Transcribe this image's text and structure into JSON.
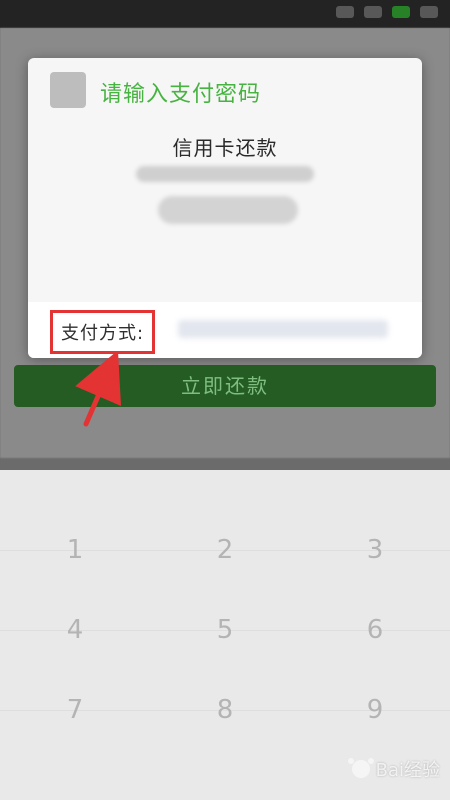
{
  "dialog": {
    "title": "请输入支付密码",
    "subtitle": "信用卡还款",
    "payment_method_label": "支付方式:"
  },
  "actions": {
    "repay_now": "立即还款"
  },
  "keypad": {
    "row1": [
      "1",
      "2",
      "3"
    ],
    "row2": [
      "4",
      "5",
      "6"
    ],
    "row3": [
      "7",
      "8",
      "9"
    ]
  },
  "watermark": {
    "text": "Bai经验"
  },
  "colors": {
    "title_green": "#47b341",
    "annotation_red": "#e33333",
    "button_green": "#1f5a1f"
  }
}
